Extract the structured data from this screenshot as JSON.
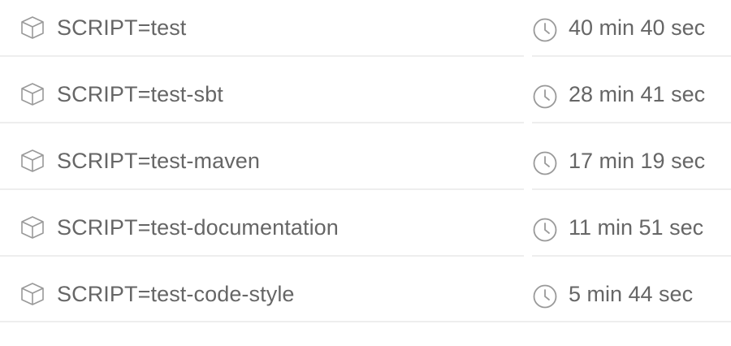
{
  "jobs": [
    {
      "name": "SCRIPT=test",
      "duration": "40 min 40 sec",
      "icon": "cube-icon",
      "duration_icon": "clock-icon"
    },
    {
      "name": "SCRIPT=test-sbt",
      "duration": "28 min 41 sec",
      "icon": "cube-icon",
      "duration_icon": "clock-icon"
    },
    {
      "name": "SCRIPT=test-maven",
      "duration": "17 min 19 sec",
      "icon": "cube-icon",
      "duration_icon": "clock-icon"
    },
    {
      "name": "SCRIPT=test-documentation",
      "duration": "11 min 51 sec",
      "icon": "cube-icon",
      "duration_icon": "clock-icon"
    },
    {
      "name": "SCRIPT=test-code-style",
      "duration": "5 min 44 sec",
      "icon": "cube-icon",
      "duration_icon": "clock-icon"
    }
  ],
  "colors": {
    "text": "#666666",
    "icon": "#999999",
    "divider": "#eeeeee",
    "background": "#ffffff"
  }
}
